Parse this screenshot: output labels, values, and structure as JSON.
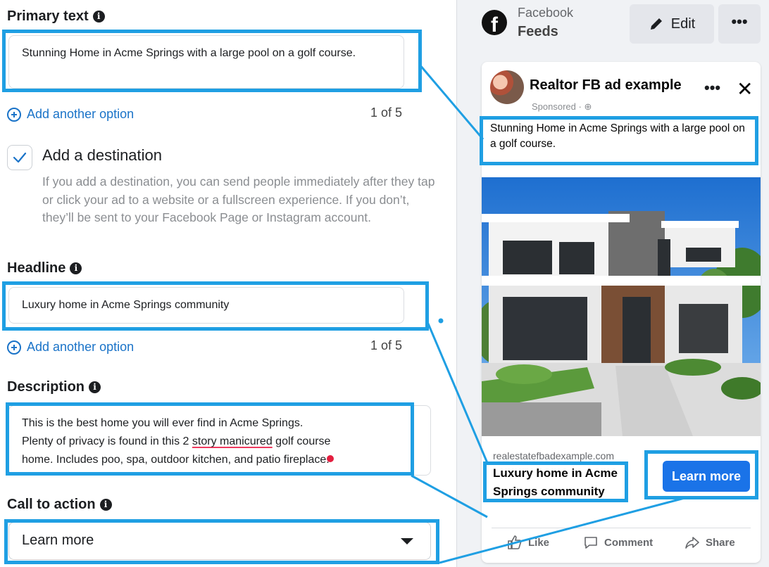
{
  "form": {
    "primary_text": {
      "label": "Primary text",
      "value": "Stunning Home in Acme Springs with a large pool on a golf course.",
      "add_option": "Add another option",
      "count": "1 of 5"
    },
    "destination": {
      "checked": true,
      "title": "Add a destination",
      "help": "If you add a destination, you can send people immediately after they tap or click your ad to a website or a fullscreen experience. If you don’t, they’ll be sent to your Facebook Page or Instagram account."
    },
    "headline": {
      "label": "Headline",
      "value": "Luxury home in Acme Springs community",
      "add_option": "Add another option",
      "count": "1 of 5"
    },
    "description": {
      "label": "Description",
      "line1": "This is the best home you will ever find in Acme Springs.",
      "line2_a": "Plenty of privacy is found in this 2 ",
      "line2_underlined": "story manicured",
      "line2_b": " golf course",
      "line3": "home. Includes poo, spa, outdoor kitchen, and patio fireplace."
    },
    "cta": {
      "label": "Call to action",
      "selected": "Learn more"
    }
  },
  "preview": {
    "platform": "Facebook",
    "placement": "Feeds",
    "edit_label": "Edit",
    "more_label": "•••",
    "page_name": "Realtor FB ad example",
    "sponsored": "Sponsored · ",
    "primary_text": "Stunning Home in Acme Springs with a large pool on a golf course.",
    "domain": "realestatefbadexample.com",
    "headline": "Luxury home in Acme Springs community",
    "cta_button": "Learn more",
    "actions": {
      "like": "Like",
      "comment": "Comment",
      "share": "Share"
    }
  },
  "colors": {
    "highlight": "#1f9fe3",
    "link_blue": "#1a73c8",
    "cta_blue": "#1a73e8",
    "spell_underline": "#f03a5f"
  }
}
